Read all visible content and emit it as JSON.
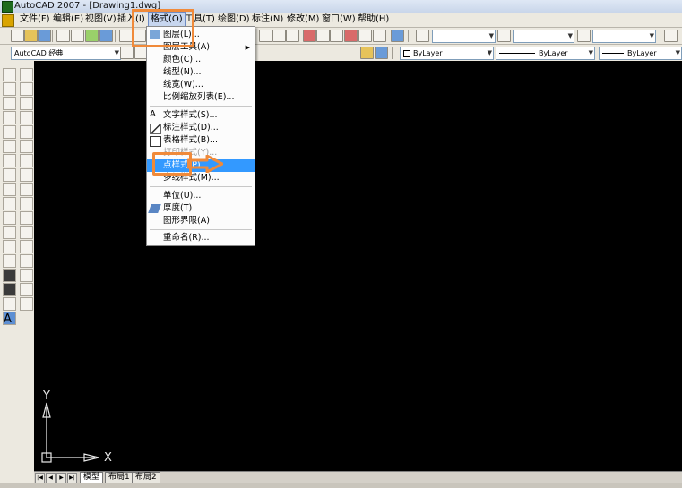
{
  "window": {
    "title": "AutoCAD 2007 - [Drawing1.dwg]"
  },
  "menubar": {
    "items": [
      {
        "label": "文件(F)"
      },
      {
        "label": "编辑(E)"
      },
      {
        "label": "视图(V)"
      },
      {
        "label": "插入(I)"
      },
      {
        "label": "格式(O)"
      },
      {
        "label": "工具(T)"
      },
      {
        "label": "绘图(D)"
      },
      {
        "label": "标注(N)"
      },
      {
        "label": "修改(M)"
      },
      {
        "label": "窗口(W)"
      },
      {
        "label": "帮助(H)"
      }
    ]
  },
  "workspace": {
    "value": "AutoCAD 经典"
  },
  "properties": {
    "color": "ByLayer",
    "linetype": "ByLayer",
    "lineweight": "ByLayer"
  },
  "format_menu": {
    "items": [
      {
        "label": "图层(L)...",
        "icon": "layers-icon"
      },
      {
        "label": "图层工具(A)",
        "submenu": true
      },
      {
        "label": "颜色(C)..."
      },
      {
        "label": "线型(N)..."
      },
      {
        "label": "线宽(W)..."
      },
      {
        "label": "比例缩放列表(E)..."
      },
      {
        "label": "文字样式(S)...",
        "icon": "text-style-icon"
      },
      {
        "label": "标注样式(D)...",
        "icon": "dim-style-icon"
      },
      {
        "label": "表格样式(B)...",
        "icon": "table-style-icon"
      },
      {
        "label": "打印样式(Y)...",
        "disabled": true
      },
      {
        "label": "点样式(P)...",
        "highlighted": true
      },
      {
        "label": "多线样式(M)..."
      },
      {
        "label": "单位(U)..."
      },
      {
        "label": "厚度(T)",
        "icon": "thickness-icon"
      },
      {
        "label": "图形界限(A)"
      },
      {
        "label": "重命名(R)..."
      }
    ]
  },
  "ucs": {
    "x_label": "X",
    "y_label": "Y"
  },
  "layout_tabs": [
    {
      "label": "模型"
    },
    {
      "label": "布局1"
    },
    {
      "label": "布局2"
    }
  ],
  "colors": {
    "highlight": "#3399ff",
    "annotation": "#f08a3a",
    "canvas": "#000000"
  }
}
